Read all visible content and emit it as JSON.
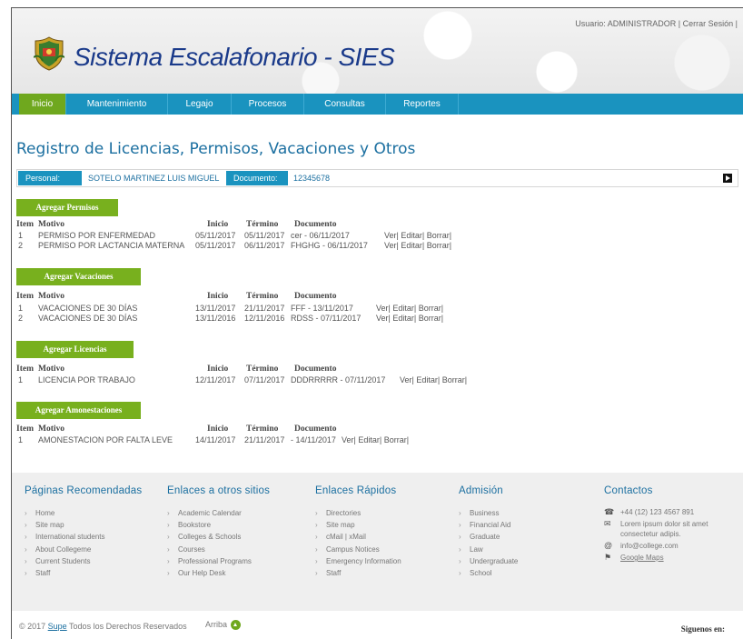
{
  "header": {
    "user_text": "Usuario: ADMINISTRADOR",
    "separator1": "|",
    "logout": "Cerrar Sesión",
    "separator2": "|",
    "site_title": "Sistema Escalafonario - SIES"
  },
  "nav": [
    "Inicio",
    "Mantenimiento",
    "Legajo",
    "Procesos",
    "Consultas",
    "Reportes"
  ],
  "page_title": "Registro de Licencias, Permisos, Vacaciones y Otros",
  "person": {
    "personal_label": "Personal:",
    "personal_value": "SOTELO MARTINEZ LUIS MIGUEL",
    "documento_label": "Documento:",
    "documento_value": "12345678"
  },
  "table_headers": {
    "item": "Item",
    "motivo": "Motivo",
    "inicio": "Inicio",
    "termino": "Término",
    "documento": "Documento"
  },
  "actions": {
    "ver": "Ver|",
    "editar": "Editar|",
    "borrar": "Borrar|"
  },
  "sections": [
    {
      "button": "Agregar Permisos",
      "rows": [
        {
          "item": "1",
          "motivo": "PERMISO POR ENFERMEDAD",
          "inicio": "05/11/2017",
          "termino": "05/11/2017",
          "documento": "cer - 06/11/2017"
        },
        {
          "item": "2",
          "motivo": "PERMISO POR LACTANCIA MATERNA",
          "inicio": "05/11/2017",
          "termino": "06/11/2017",
          "documento": "FHGHG - 06/11/2017"
        }
      ]
    },
    {
      "button": "Agregar Vacaciones",
      "rows": [
        {
          "item": "1",
          "motivo": "VACACIONES DE 30 DÍAS",
          "inicio": "13/11/2017",
          "termino": "21/11/2017",
          "documento": "FFF - 13/11/2017"
        },
        {
          "item": "2",
          "motivo": "VACACIONES DE 30 DÍAS",
          "inicio": "13/11/2016",
          "termino": "12/11/2016",
          "documento": "RDSS - 07/11/2017"
        }
      ]
    },
    {
      "button": "Agregar Licencias",
      "rows": [
        {
          "item": "1",
          "motivo": "LICENCIA POR TRABAJO",
          "inicio": "12/11/2017",
          "termino": "07/11/2017",
          "documento": "DDDRRRRR - 07/11/2017"
        }
      ]
    },
    {
      "button": "Agregar Amonestaciones",
      "rows": [
        {
          "item": "1",
          "motivo": "AMONESTACION POR FALTA LEVE",
          "inicio": "14/11/2017",
          "termino": "21/11/2017",
          "documento": " - 14/11/2017"
        }
      ]
    }
  ],
  "footer": {
    "col1": {
      "title": "Páginas Recomendadas",
      "items": [
        "Home",
        "Site map",
        "International students",
        "About Collegeme",
        "Current Students",
        "Staff"
      ]
    },
    "col2": {
      "title": "Enlaces a otros sitios",
      "items": [
        "Academic Calendar",
        "Bookstore",
        "Colleges & Schools",
        "Courses",
        "Professional Programs",
        "Our Help Desk"
      ]
    },
    "col3": {
      "title": "Enlaces Rápidos",
      "items": [
        "Directories",
        "Site map",
        "cMail | xMail",
        "Campus Notices",
        "Emergency Information",
        "Staff"
      ]
    },
    "col4": {
      "title": "Admisión",
      "items": [
        "Business",
        "Financial Aid",
        "Graduate",
        "Law",
        "Undergraduate",
        "School"
      ]
    },
    "contact": {
      "title": "Contactos",
      "phone": "+44 (12) 123 4567 891",
      "address": "Lorem ipsum dolor sit amet consectetur adipis.",
      "email": "info@college.com",
      "maps": "Google Maps"
    }
  },
  "bottom": {
    "copyright_pre": "© 2017",
    "copyright_link": "Supe",
    "copyright_post": "Todos los Derechos Reservados",
    "arriba": "Arriba",
    "siguenos": "Siguenos en:"
  },
  "colors": {
    "nav_blue": "#1a93bf",
    "green": "#78b01e",
    "title_blue": "#1b6fa0"
  }
}
